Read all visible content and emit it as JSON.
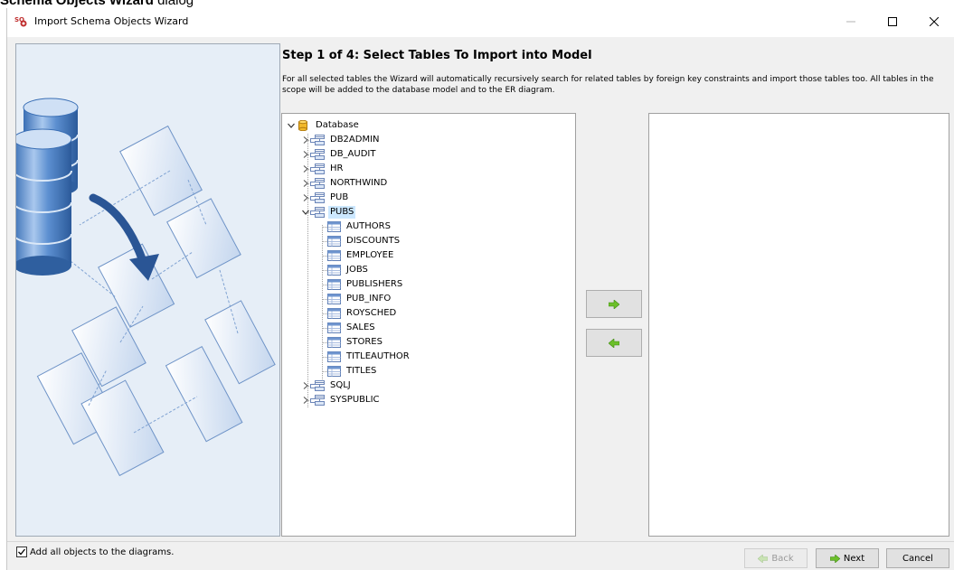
{
  "caption": {
    "prefix": "Schema Objects Wizard",
    "suffix": " dialog"
  },
  "window": {
    "title": "Import Schema Objects Wizard",
    "controls": [
      "minimize",
      "maximize",
      "close"
    ]
  },
  "step": {
    "title": "Step 1 of 4:  Select Tables To Import into Model",
    "description": "For all selected tables the Wizard will automatically recursively search for related tables by foreign key constraints and import those tables too. All tables in the scope will be added to the database model and to the ER diagram."
  },
  "tree": {
    "root": {
      "label": "Database",
      "icon": "database-icon",
      "expanded": true
    },
    "schemas": [
      {
        "label": "DB2ADMIN",
        "expanded": false
      },
      {
        "label": "DB_AUDIT",
        "expanded": false
      },
      {
        "label": "HR",
        "expanded": false
      },
      {
        "label": "NORTHWIND",
        "expanded": false
      },
      {
        "label": "PUB",
        "expanded": false
      },
      {
        "label": "PUBS",
        "expanded": true,
        "selected": true
      },
      {
        "label": "SQLJ",
        "expanded": false
      },
      {
        "label": "SYSPUBLIC",
        "expanded": false
      }
    ],
    "tables": [
      "AUTHORS",
      "DISCOUNTS",
      "EMPLOYEE",
      "JOBS",
      "PUBLISHERS",
      "PUB_INFO",
      "ROYSCHED",
      "SALES",
      "STORES",
      "TITLEAUTHOR",
      "TITLES"
    ]
  },
  "selected_tables": [],
  "transfer": {
    "add_icon": "arrow-right-icon",
    "remove_icon": "arrow-left-icon"
  },
  "options": {
    "add_all_label": "Add all objects to the diagrams.",
    "add_all_checked": true
  },
  "buttons": {
    "back": "Back",
    "next": "Next",
    "cancel": "Cancel",
    "back_enabled": false
  },
  "colors": {
    "arrow_green": "#6cbf2a",
    "selection": "#cce8ff",
    "panel_bg": "#f0f0f0"
  }
}
